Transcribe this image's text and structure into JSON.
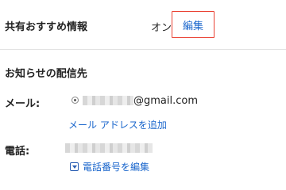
{
  "sharing": {
    "title": "共有おすすめ情報",
    "status": "オン",
    "edit_label": "編集"
  },
  "notifications": {
    "title": "お知らせの配信先",
    "email_label": "メール:",
    "email_domain": "@gmail.com",
    "add_email_link": "メール アドレスを追加",
    "phone_label": "電話:",
    "edit_phone_link": "電話番号を編集"
  },
  "colors": {
    "link": "#1a66cc",
    "edit_border": "#ea4335"
  }
}
